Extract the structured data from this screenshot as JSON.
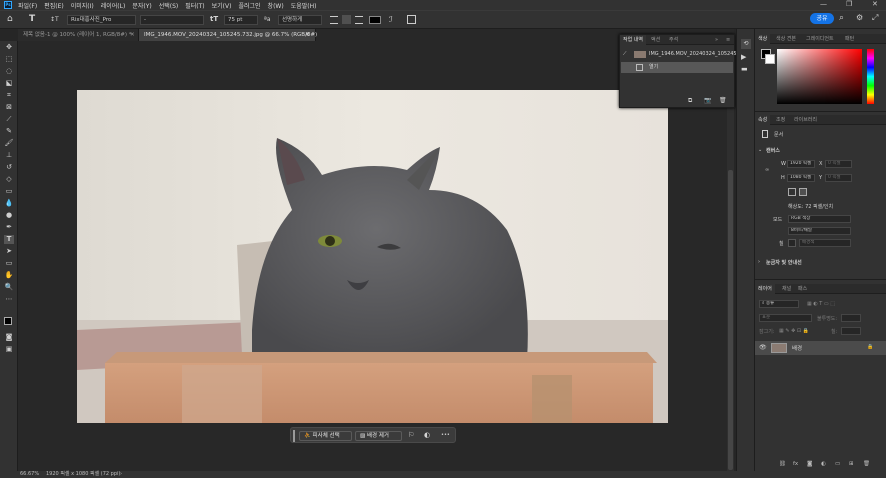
{
  "menubar": {
    "app_icon": "Ps",
    "items": [
      "파일(F)",
      "편집(E)",
      "이미지(I)",
      "레이어(L)",
      "문자(Y)",
      "선택(S)",
      "필터(T)",
      "보기(V)",
      "플러그인",
      "창(W)",
      "도움말(H)"
    ],
    "minimize": "—",
    "restore": "❐",
    "close": "✕"
  },
  "options": {
    "home": "⌂",
    "tool": "T",
    "orient": "↕T",
    "font_family": "Rix대흥사진_Pro",
    "font_style": "-",
    "size_icon": "tT",
    "font_size": "75 pt",
    "aa_icon": "ªa",
    "antialias": "선명하게",
    "share": "공유",
    "search": "⌕",
    "settings": "⚙",
    "expand": "⤢"
  },
  "tabs": [
    {
      "label": "제목 없음-1 @ 100% (레이어 1, RGB/8#) *",
      "close": "✕"
    },
    {
      "label": "IMG_1946.MOV_20240324_105245.732.jpg @ 66.7% (RGB/8#)",
      "close": "✕"
    }
  ],
  "history": {
    "tabs": [
      "작업 내역",
      "액션",
      "주석"
    ],
    "snapshot": "IMG_1946.MOV_20240324_105245...",
    "step": "열기",
    "collapse": "»",
    "menu": "≡"
  },
  "context_bar": {
    "select_subject": "피사체 선택",
    "remove_bg": "배경 제거",
    "more": "•••"
  },
  "status": {
    "zoom": "66.67%",
    "info": "1920 픽셀 x 1080 픽셀 (72 ppi)",
    "arrow": "›"
  },
  "color_panel": {
    "tabs": [
      "색상",
      "색상 견본",
      "그레이디언트",
      "패턴"
    ],
    "foreground": "#000000",
    "background": "#ffffff",
    "hue": "#ff0000"
  },
  "properties": {
    "tabs": [
      "속성",
      "조정",
      "라이브러리"
    ],
    "doc_label": "문서",
    "canvas_section": "캔버스",
    "w_label": "W",
    "w_value": "1920 픽셀",
    "x_label": "X",
    "x_placeholder": "0 픽셀",
    "h_label": "H",
    "h_value": "1080 픽셀",
    "y_label": "Y",
    "y_placeholder": "0 픽셀",
    "resolution": "해상도: 72 픽셀/인치",
    "mode_label": "모드",
    "mode_value": "RGB 색상",
    "bit_value": "8비트/채널",
    "fill_label": "칠",
    "fill_value": "배경색",
    "rulers_section": "눈금자 및 안내선"
  },
  "layers": {
    "tabs": [
      "레이어",
      "채널",
      "패스"
    ],
    "filter_label": "종류",
    "blend_mode": "표준",
    "opacity_label": "불투명도:",
    "lock_label": "잠그기:",
    "fill_label": "칠:",
    "layer_name": "배경",
    "visibility": "👁",
    "lock": "🔒",
    "footer_fx": "fx"
  }
}
